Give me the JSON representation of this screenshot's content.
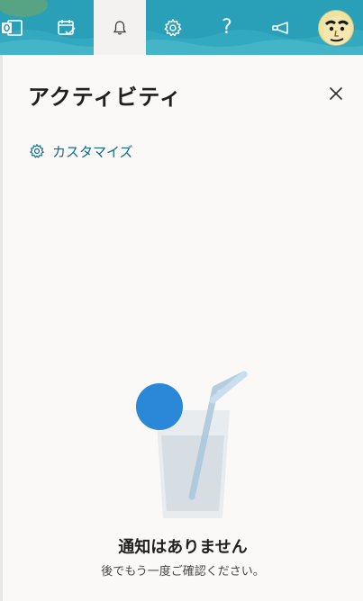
{
  "header": {
    "apps": [
      {
        "icon": "outlook-icon"
      },
      {
        "icon": "calendar-check-icon"
      },
      {
        "icon": "bell-icon",
        "active": true
      },
      {
        "icon": "gear-icon"
      },
      {
        "icon": "help-icon"
      },
      {
        "icon": "megaphone-icon"
      }
    ],
    "help_glyph": "?",
    "accent": "#2aa0b8"
  },
  "panel": {
    "title": "アクティビティ",
    "customize_label": "カスタマイズ",
    "empty_title": "通知はありません",
    "empty_subtitle": "後でもう一度ご確認ください。",
    "link_color": "#0f6b86"
  }
}
